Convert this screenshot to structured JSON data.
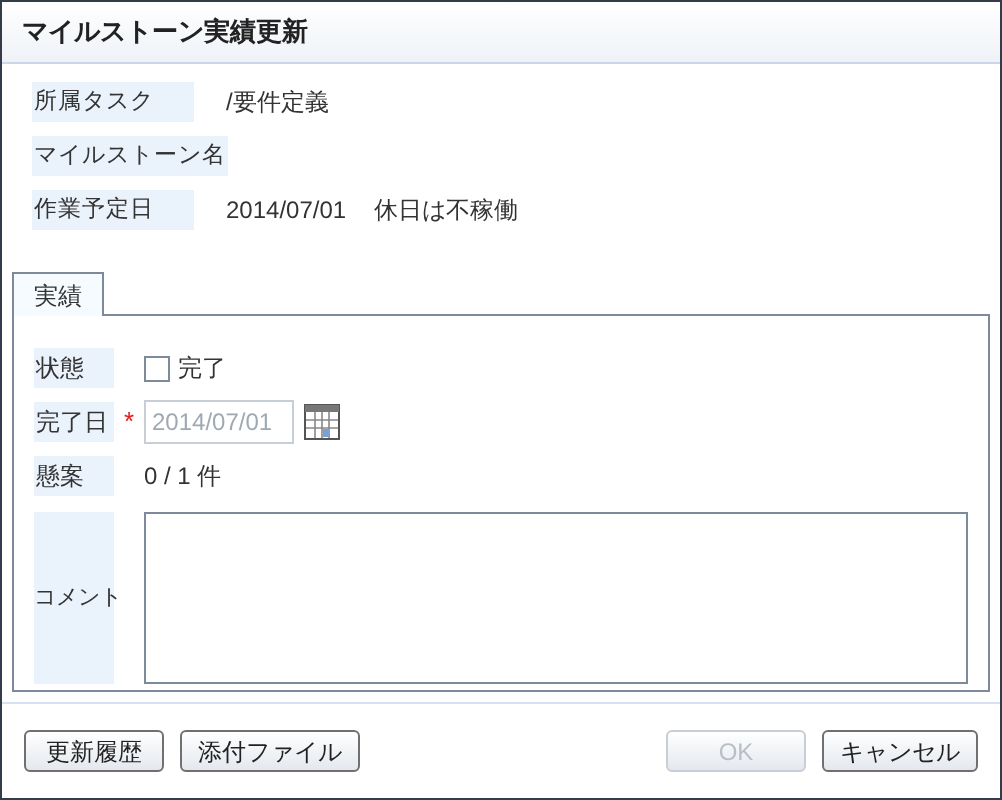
{
  "window": {
    "title": "マイルストーン実績更新"
  },
  "info": [
    {
      "label": "所属タスク",
      "value": "/要件定義"
    },
    {
      "label": "マイルストーン名"
    },
    {
      "label": "作業予定日",
      "value": "2014/07/01",
      "note": "休日は不稼働"
    }
  ],
  "tabs": [
    {
      "label": "実績",
      "selected": true
    }
  ],
  "form": {
    "status": {
      "label": "状態",
      "checkbox_label": "完了",
      "checked": false
    },
    "done_date": {
      "label": "完了日",
      "required_mark": "*",
      "value": "2014/07/01",
      "disabled": true
    },
    "issues": {
      "label": "懸案",
      "value": "0 / 1 件"
    },
    "comment": {
      "label": "コメント"
    }
  },
  "buttons": [
    {
      "label": "更新履歴",
      "disabled": false
    },
    {
      "label": "添付ファイル",
      "disabled": false
    },
    {
      "label": "OK",
      "disabled": true
    },
    {
      "label": "キャンセル",
      "disabled": false
    }
  ]
}
